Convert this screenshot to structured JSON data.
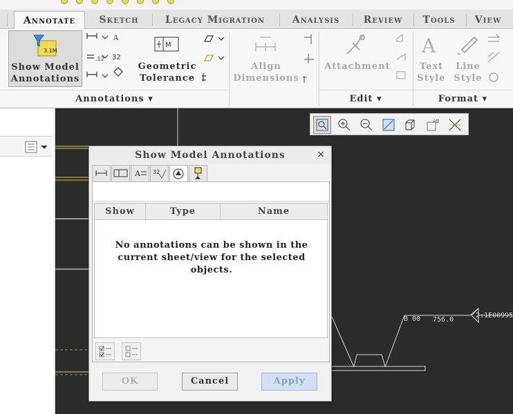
{
  "tabs": [
    "Annotate",
    "Sketch",
    "Legacy Migration",
    "Analysis",
    "Review",
    "Tools",
    "View"
  ],
  "active_tab": "Annotate",
  "ribbon": {
    "show_model": {
      "line1": "Show Model",
      "line2": "Annotations"
    },
    "geometric_tolerance": {
      "line1": "Geometric",
      "line2": "Tolerance"
    },
    "align_dimensions": {
      "line1": "Align",
      "line2": "Dimensions"
    },
    "attachment": "Attachment",
    "text_style": {
      "line1": "Text",
      "line2": "Style"
    },
    "line_style": {
      "line1": "Line",
      "line2": "Style"
    },
    "group_annotations": "Annotations",
    "group_edit": "Edit",
    "group_format": "Format",
    "dropdown_arrow": "▾"
  },
  "canvas": {
    "callout_left": "B 00",
    "callout_value": "756.0",
    "callout_id": "2:1E00995"
  },
  "dialog": {
    "title": "Show Model Annotations",
    "close": "×",
    "columns": {
      "show": "Show",
      "type": "Type",
      "name": "Name"
    },
    "empty_message": "No annotations can be shown in the current sheet/view for the selected objects.",
    "ok": "OK",
    "cancel": "Cancel",
    "apply": "Apply"
  }
}
